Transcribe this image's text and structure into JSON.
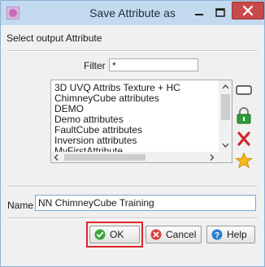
{
  "window": {
    "title": "Save Attribute as",
    "icon": "app-icon",
    "controls": {
      "minimize": "minimize-icon",
      "maximize": "maximize-icon",
      "close": "close-icon"
    }
  },
  "header": {
    "label": "Select output Attribute"
  },
  "filter": {
    "label": "Filter",
    "value": "*"
  },
  "list": {
    "items": [
      "3D UVQ Attribs Texture + HC",
      "ChimneyCube attributes",
      "DEMO",
      "Demo attributes",
      "FaultCube attributes",
      "Inversion attributes",
      "MyFirstAttribute"
    ]
  },
  "side_tools": [
    "rename-icon",
    "lock-icon",
    "delete-icon",
    "set-default-icon"
  ],
  "name": {
    "label": "Name",
    "value": "NN ChimneyCube Training"
  },
  "buttons": {
    "ok": "OK",
    "cancel": "Cancel",
    "help": "Help"
  },
  "colors": {
    "titlebar": "#c3d9ee",
    "close": "#c94a4a",
    "highlight": "#e0262a"
  }
}
